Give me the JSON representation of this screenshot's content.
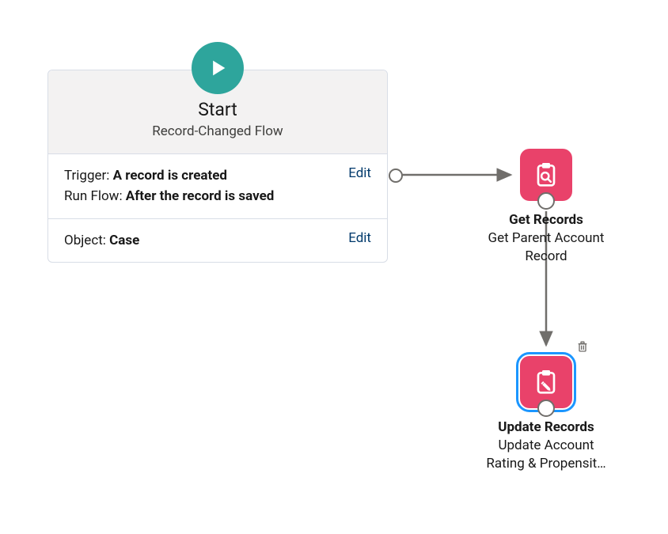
{
  "start": {
    "title": "Start",
    "subtitle": "Record-Changed Flow",
    "trigger_label": "Trigger: ",
    "trigger_value": "A record is created",
    "runflow_label": "Run Flow: ",
    "runflow_value": "After the record is saved",
    "object_label": "Object: ",
    "object_value": "Case",
    "edit_label": "Edit"
  },
  "nodes": {
    "get_records": {
      "title": "Get Records",
      "desc_line1": "Get Parent Account",
      "desc_line2": "Record"
    },
    "update_records": {
      "title": "Update Records",
      "desc_line1": "Update Account",
      "desc_line2": "Rating & Propensit…"
    }
  },
  "icons": {
    "play": "play-icon",
    "clipboard_search": "clipboard-search-icon",
    "clipboard_edit": "clipboard-edit-icon",
    "trash": "trash-icon"
  },
  "colors": {
    "teal": "#2ea59c",
    "pink": "#e9426a",
    "link": "#00396b",
    "selection": "#1b96ff",
    "connector": "#706e6b"
  }
}
